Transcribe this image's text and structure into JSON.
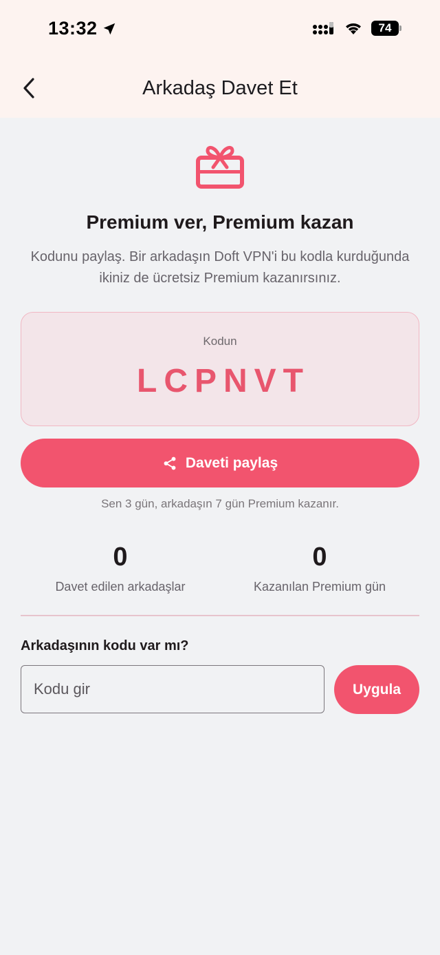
{
  "status_bar": {
    "time": "13:32",
    "battery": "74"
  },
  "header": {
    "title": "Arkadaş Davet Et"
  },
  "hero": {
    "headline": "Premium ver, Premium kazan",
    "description": "Kodunu paylaş. Bir arkadaşın Doft VPN'i bu kodla kurduğunda ikiniz de ücretsiz Premium kazanırsınız."
  },
  "code_card": {
    "label": "Kodun",
    "code": "LCPNVT"
  },
  "share_button": {
    "label": "Daveti paylaş"
  },
  "reward_note": "Sen 3 gün, arkadaşın 7 gün Premium kazanır.",
  "stats": {
    "invited": {
      "value": "0",
      "label": "Davet edilen arkadaşlar"
    },
    "earned": {
      "value": "0",
      "label": "Kazanılan Premium gün"
    }
  },
  "redeem": {
    "question": "Arkadaşının kodu var mı?",
    "input_value": "",
    "input_placeholder": "Kodu gir",
    "apply_label": "Uygula"
  },
  "colors": {
    "accent": "#f2546e",
    "code_text": "#e8566e",
    "card_background": "#f3e5e9",
    "header_background": "#fdf3f0",
    "page_background": "#f1f2f4"
  }
}
